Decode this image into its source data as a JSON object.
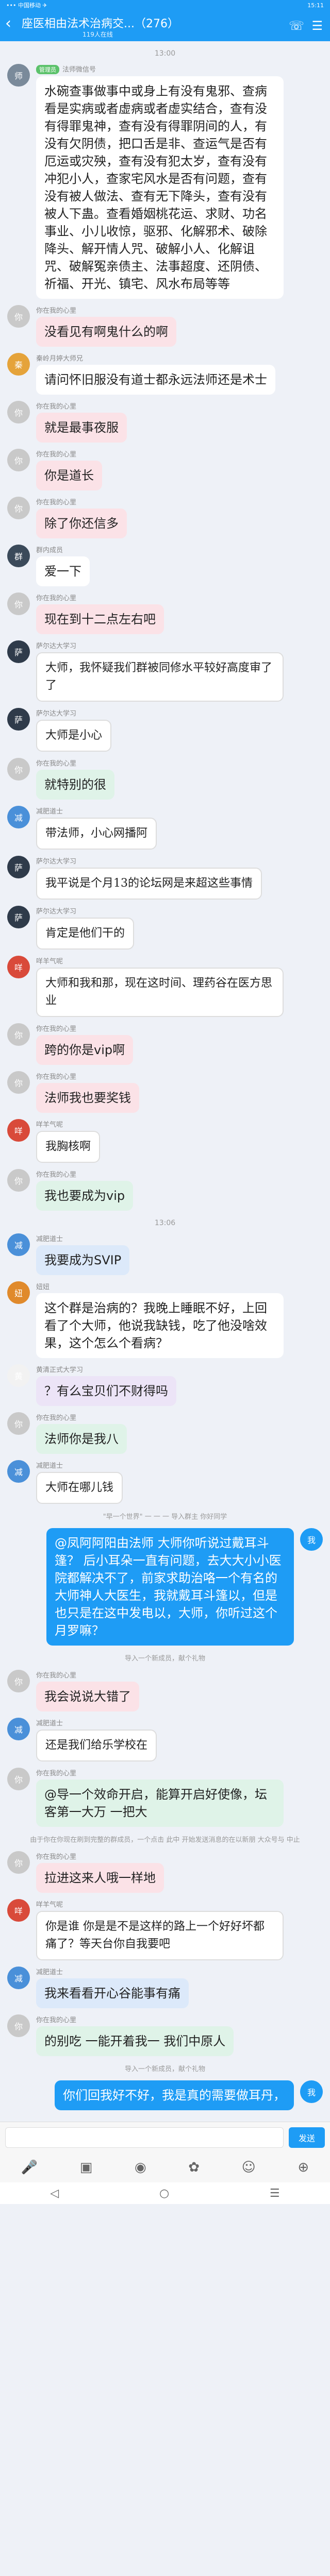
{
  "status": {
    "left": "••• 中国移动 ✈",
    "right": "15:11"
  },
  "header": {
    "back": "‹",
    "title": "座医相由法术治病交...（276）",
    "subtitle": "119人在线",
    "icon1": "phone-icon",
    "icon2": "people-icon"
  },
  "messages": [
    {
      "type": "time",
      "text": "13:00"
    },
    {
      "type": "msg",
      "sender_tag": "管理员",
      "sender": "法师微信号",
      "avatar_color": "#7a8a9a",
      "avatar_text": "师",
      "text": "水碗查事做事中或身上有没有鬼邪、查病看是实病或者虚病或者虚实结合，查有没有得罪鬼神，查有没有得罪阴间的人，有没有欠阴债，把口舌是非、查运气是否有厄运或灾殃，查有没有犯太岁，查有没有冲犯小人，查家宅风水是否有问题，查有没有被人做法、查有无下降头，查有没有被人下蛊。查看婚姻桃花运、求财、功名事业、小儿收惊，驱邪、化解邪术、破除降头、解开情人咒、破解小人、化解诅咒、破解冤亲债主、法事超度、还阴债、祈福、开光、镇宅、风水布局等等",
      "bubble": ""
    },
    {
      "type": "msg",
      "sender": "你在我的心里",
      "avatar_color": "#c9c9c9",
      "avatar_text": "你",
      "text": "没看见有啊鬼什么的啊",
      "bubble": "pink"
    },
    {
      "type": "msg",
      "sender": "秦岭月婷大师兄",
      "avatar_color": "#e5a33a",
      "avatar_text": "秦",
      "text": "请问怀旧服没有道士都永远法师还是术士",
      "bubble": ""
    },
    {
      "type": "msg",
      "sender": "你在我的心里",
      "avatar_color": "#c9c9c9",
      "avatar_text": "你",
      "text": "就是最事夜服",
      "bubble": "pink"
    },
    {
      "type": "msg",
      "sender": "你在我的心里",
      "avatar_color": "#c9c9c9",
      "avatar_text": "你",
      "text": "你是道长",
      "bubble": "pink"
    },
    {
      "type": "msg",
      "sender": "你在我的心里",
      "avatar_color": "#c9c9c9",
      "avatar_text": "你",
      "text": "除了你还信多",
      "bubble": "pink"
    },
    {
      "type": "msg",
      "sender": "群内成员",
      "avatar_color": "#3b4a5a",
      "avatar_text": "群",
      "text": "爱一下",
      "bubble": ""
    },
    {
      "type": "msg",
      "sender": "你在我的心里",
      "avatar_color": "#c9c9c9",
      "avatar_text": "你",
      "text": "现在到十二点左右吧",
      "bubble": "pink"
    },
    {
      "type": "msg",
      "sender": "萨尔达大学习",
      "avatar_color": "#2f3b4a",
      "avatar_text": "萨",
      "text": "大师，我怀疑我们群被同修水平较好高度审了了",
      "bubble": "hand"
    },
    {
      "type": "msg",
      "sender": "萨尔达大学习",
      "avatar_color": "#2f3b4a",
      "avatar_text": "萨",
      "text": "大师是小心",
      "bubble": "hand"
    },
    {
      "type": "msg",
      "sender": "你在我的心里",
      "avatar_color": "#c9c9c9",
      "avatar_text": "你",
      "text": "就特别的很",
      "bubble": "mint"
    },
    {
      "type": "msg",
      "sender": "减肥道士",
      "avatar_color": "#4a90d9",
      "avatar_text": "减",
      "text": "带法师，小心网播阿",
      "bubble": "hand"
    },
    {
      "type": "msg",
      "sender": "萨尔达大学习",
      "avatar_color": "#2f3b4a",
      "avatar_text": "萨",
      "text": "我平说是个月13的论坛网是来超这些事情",
      "bubble": "hand"
    },
    {
      "type": "msg",
      "sender": "萨尔达大学习",
      "avatar_color": "#2f3b4a",
      "avatar_text": "萨",
      "text": "肯定是他们干的",
      "bubble": "hand"
    },
    {
      "type": "msg",
      "sender": "咩羊气呢",
      "avatar_color": "#d94a3a",
      "avatar_text": "咩",
      "text": "大师和我和那，现在这时间、理药谷在医方思业",
      "bubble": "hand"
    },
    {
      "type": "msg",
      "sender": "你在我的心里",
      "avatar_color": "#c9c9c9",
      "avatar_text": "你",
      "text": "跨的你是vip啊",
      "bubble": "pink"
    },
    {
      "type": "msg",
      "sender": "你在我的心里",
      "avatar_color": "#c9c9c9",
      "avatar_text": "你",
      "text": "法师我也要奖钱",
      "bubble": "pink"
    },
    {
      "type": "msg",
      "sender": "咩羊气呢",
      "avatar_color": "#d94a3a",
      "avatar_text": "咩",
      "text": "我胸核啊",
      "bubble": "hand"
    },
    {
      "type": "msg",
      "sender": "你在我的心里",
      "avatar_color": "#c9c9c9",
      "avatar_text": "你",
      "text": "我也要成为vip",
      "bubble": "mint"
    },
    {
      "type": "time",
      "text": "13:06"
    },
    {
      "type": "msg",
      "sender": "减肥道士",
      "avatar_color": "#4a90d9",
      "avatar_text": "减",
      "text": "我要成为SVIP",
      "bubble": "sky"
    },
    {
      "type": "msg",
      "sender": "妞妞",
      "avatar_color": "#e08a2c",
      "avatar_text": "妞",
      "text": "这个群是治病的？我晚上睡眠不好，上回看了个大师，他说我缺钱，吃了他没啥效果，这个怎么个看病？",
      "bubble": ""
    },
    {
      "type": "msg",
      "sender": "黄清正式大学习",
      "avatar_color": "#f2f2f2",
      "avatar_text": "黄",
      "text": "？有么宝贝们不财得吗",
      "bubble": "lav"
    },
    {
      "type": "msg",
      "sender": "你在我的心里",
      "avatar_color": "#c9c9c9",
      "avatar_text": "你",
      "text": "法师你是我八",
      "bubble": "mint"
    },
    {
      "type": "msg",
      "sender": "减肥道士",
      "avatar_color": "#4a90d9",
      "avatar_text": "减",
      "text": "大师在哪儿钱",
      "bubble": "hand"
    },
    {
      "type": "system",
      "text": "\"早一个世界\" 一 一 一 导入群主 你好同学"
    },
    {
      "type": "me",
      "sender": "我",
      "avatar_color": "#1e9cf5",
      "avatar_text": "我",
      "text": "@凤阿阿阳由法师 大师你听说过戴耳斗篷？ 后小耳朵一直有问题，去大大小小医院都解决不了，前家求助治咯一个有名的大师神人大医生，我就戴耳斗篷以，但是也只是在这中发电以，大师，你听过这个月罗嘛？"
    },
    {
      "type": "system",
      "text": "导入一个新成员，献个礼物"
    },
    {
      "type": "msg",
      "sender": "你在我的心里",
      "avatar_color": "#c9c9c9",
      "avatar_text": "你",
      "text": "我会说说大错了",
      "bubble": "pink"
    },
    {
      "type": "msg",
      "sender": "减肥道士",
      "avatar_color": "#4a90d9",
      "avatar_text": "减",
      "text": "还是我们给乐学校在",
      "bubble": "hand"
    },
    {
      "type": "msg",
      "sender": "你在我的心里",
      "avatar_color": "#c9c9c9",
      "avatar_text": "你",
      "text": "@导一个效命开启，能算开启好使像，坛客第一大万 一把大",
      "bubble": "mint"
    },
    {
      "type": "system",
      "text": "由于你在你现在刷到完整的群成员，一个点击 此中 开始发送消息的在以新朋 大众号与 中止"
    },
    {
      "type": "msg",
      "sender": "你在我的心里",
      "avatar_color": "#c9c9c9",
      "avatar_text": "你",
      "text": "拉进这来人哦一样地",
      "bubble": "pink"
    },
    {
      "type": "msg",
      "sender": "咩羊气呢",
      "avatar_color": "#d94a3a",
      "avatar_text": "咩",
      "text": "你是谁 你是是不是这样的路上一个好好坏都痛了？等天台你自我要吧",
      "bubble": "hand"
    },
    {
      "type": "msg",
      "sender": "减肥道士",
      "avatar_color": "#4a90d9",
      "avatar_text": "减",
      "text": "我来看看开心谷能事有痛",
      "bubble": "sky"
    },
    {
      "type": "msg",
      "sender": "你在我的心里",
      "avatar_color": "#c9c9c9",
      "avatar_text": "你",
      "text": "的别吃 一能开着我一 我们中原人",
      "bubble": "mint"
    },
    {
      "type": "system",
      "text": "导入一个新成员，献个礼物"
    },
    {
      "type": "me",
      "sender": "我",
      "avatar_color": "#1e9cf5",
      "avatar_text": "我",
      "text": "你们回我好不好，我是真的需要做耳丹，"
    }
  ],
  "input": {
    "placeholder": "",
    "send_label": "发送"
  },
  "toolbar": [
    "mic-icon",
    "image-icon",
    "camera-icon",
    "gift-icon",
    "emoji-icon",
    "plus-icon"
  ],
  "navbar": [
    "back-nav-icon",
    "home-nav-icon",
    "menu-nav-icon"
  ]
}
